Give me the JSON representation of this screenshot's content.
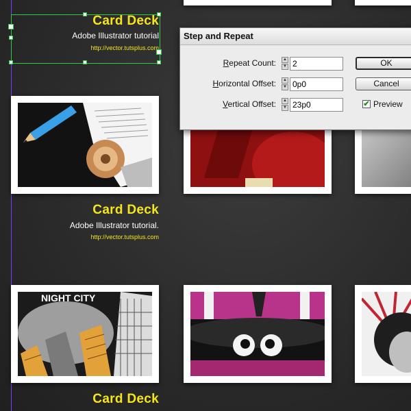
{
  "card_text": {
    "title": "Card Deck",
    "subtitle_1": "Adobe Illustrator  tutorial",
    "subtitle_2": "Adobe Illustrator  tutorial.",
    "url": "http://vector.tutsplus.com"
  },
  "cards": {
    "row2": {
      "card1": {
        "sign_text": "NIGHT CITY"
      }
    }
  },
  "dialog": {
    "title": "Step and Repeat",
    "repeat_count": {
      "label_key": "R",
      "label_rest": "epeat Count:",
      "value": "2"
    },
    "horizontal_offset": {
      "label_key": "H",
      "label_rest": "orizontal Offset:",
      "value": "0p0"
    },
    "vertical_offset": {
      "label_key": "V",
      "label_rest": "ertical Offset:",
      "value": "23p0"
    },
    "ok_label": "OK",
    "cancel_label": "Cancel",
    "preview_label": "Preview",
    "preview_checked": true,
    "check_mark": "✔",
    "spin_up": "▲",
    "spin_down": "▼"
  },
  "colors": {
    "title_yellow": "#f5e61c",
    "selection_green": "#2ecc40",
    "guide_purple": "#7a3cff"
  }
}
